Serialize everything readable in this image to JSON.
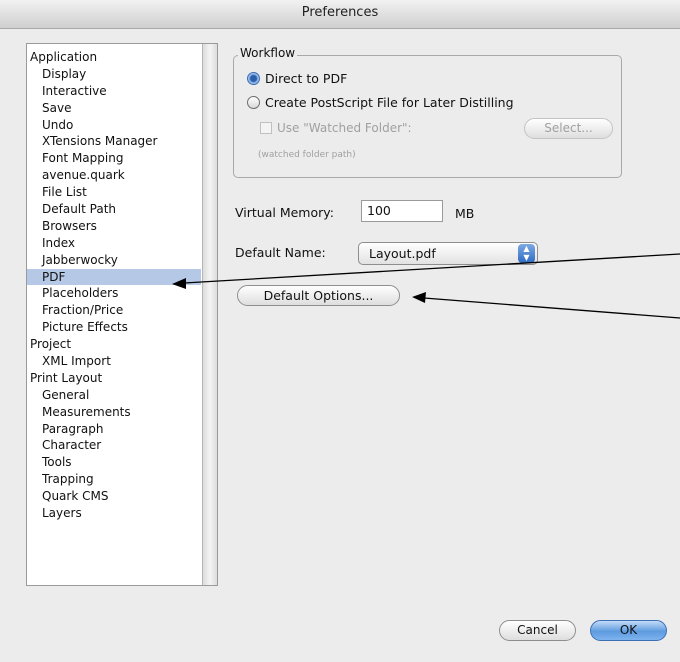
{
  "window": {
    "title": "Preferences"
  },
  "sidebar": {
    "items": [
      {
        "label": "Application",
        "level": 0
      },
      {
        "label": "Display",
        "level": 1
      },
      {
        "label": "Interactive",
        "level": 1
      },
      {
        "label": "Save",
        "level": 1
      },
      {
        "label": "Undo",
        "level": 1
      },
      {
        "label": "XTensions Manager",
        "level": 1
      },
      {
        "label": "Font Mapping",
        "level": 1
      },
      {
        "label": "avenue.quark",
        "level": 1
      },
      {
        "label": "File List",
        "level": 1
      },
      {
        "label": "Default Path",
        "level": 1
      },
      {
        "label": "Browsers",
        "level": 1
      },
      {
        "label": "Index",
        "level": 1
      },
      {
        "label": "Jabberwocky",
        "level": 1
      },
      {
        "label": "PDF",
        "level": 1,
        "selected": true
      },
      {
        "label": "Placeholders",
        "level": 1
      },
      {
        "label": "Fraction/Price",
        "level": 1
      },
      {
        "label": "Picture Effects",
        "level": 1
      },
      {
        "label": "Project",
        "level": 0
      },
      {
        "label": "XML Import",
        "level": 1
      },
      {
        "label": "Print Layout",
        "level": 0
      },
      {
        "label": "General",
        "level": 1
      },
      {
        "label": "Measurements",
        "level": 1
      },
      {
        "label": "Paragraph",
        "level": 1
      },
      {
        "label": "Character",
        "level": 1
      },
      {
        "label": "Tools",
        "level": 1
      },
      {
        "label": "Trapping",
        "level": 1
      },
      {
        "label": "Quark CMS",
        "level": 1
      },
      {
        "label": "Layers",
        "level": 1
      }
    ]
  },
  "workflow": {
    "group_label": "Workflow",
    "direct_to_pdf": "Direct to PDF",
    "create_postscript": "Create PostScript File for Later Distilling",
    "use_watched_folder": "Use \"Watched Folder\":",
    "select_button": "Select...",
    "watched_folder_path": "(watched folder path)",
    "selected_option": "Direct to PDF"
  },
  "settings": {
    "virtual_memory_label": "Virtual Memory:",
    "virtual_memory_value": "100",
    "virtual_memory_unit": "MB",
    "default_name_label": "Default Name:",
    "default_name_value": "Layout.pdf",
    "default_options_button": "Default Options..."
  },
  "footer": {
    "cancel": "Cancel",
    "ok": "OK"
  },
  "colors": {
    "selection": "#b5c9e6",
    "accent": "#2e6bc4",
    "window_bg": "#ececec"
  }
}
